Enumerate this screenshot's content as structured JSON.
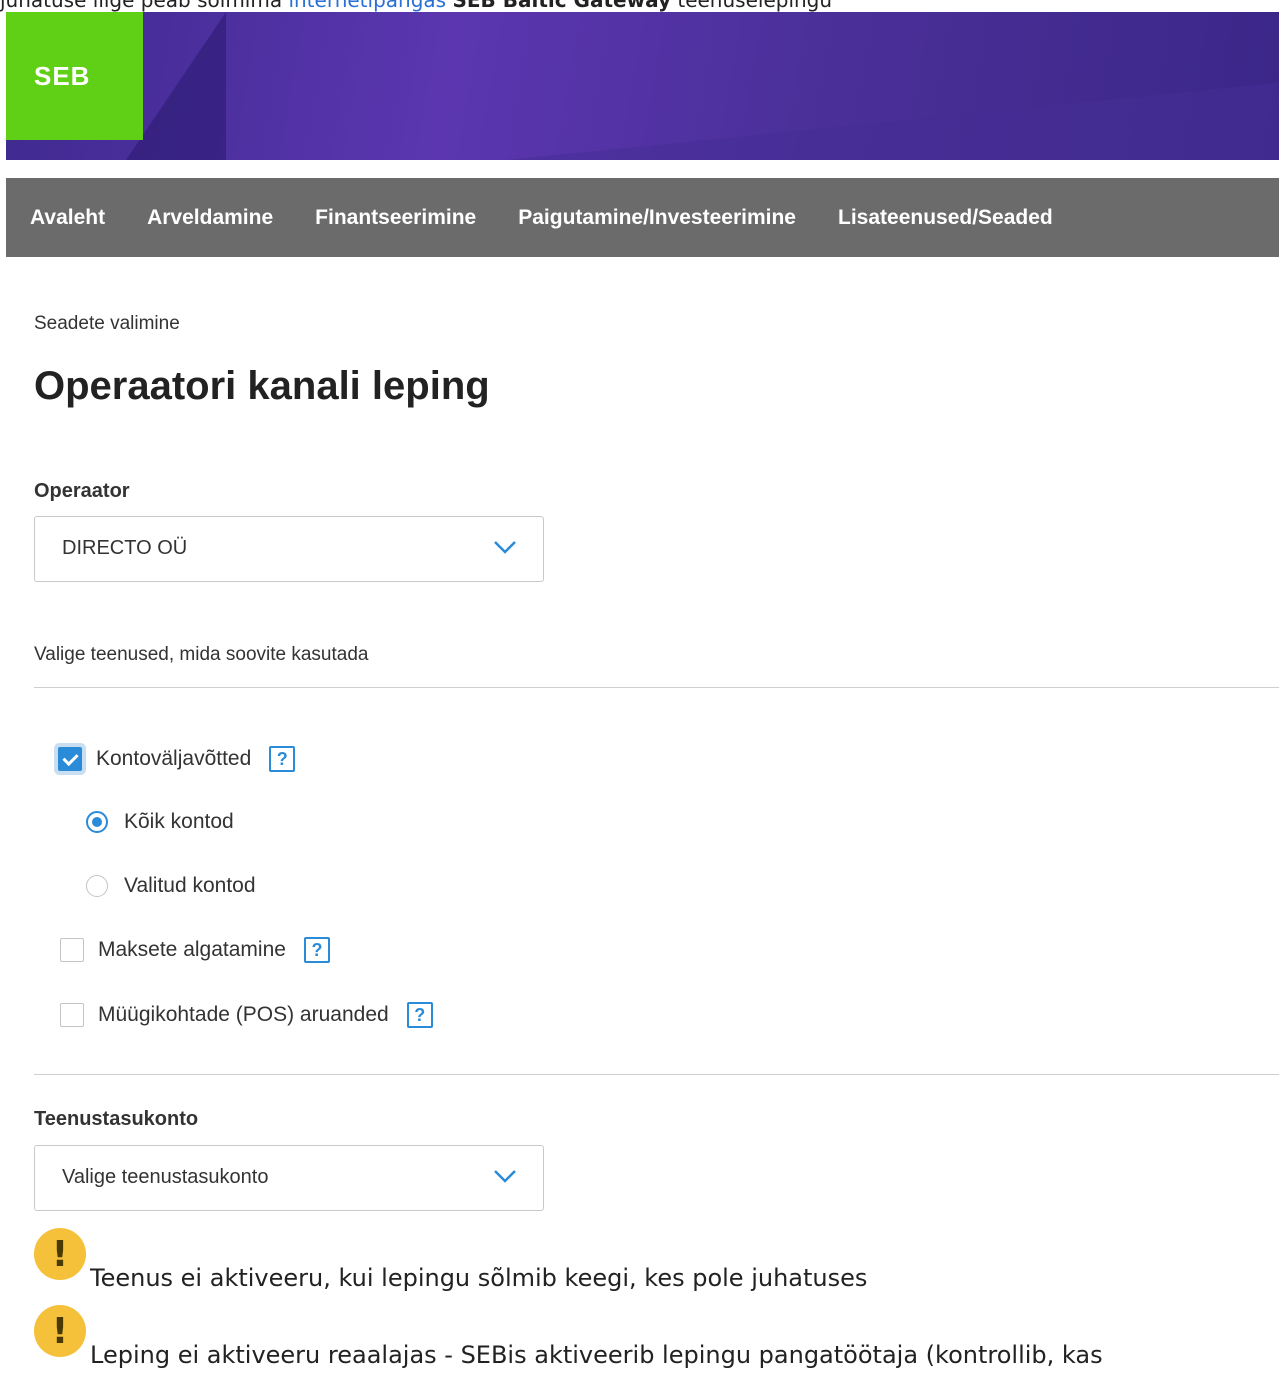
{
  "top_text": {
    "prefix": "juhatuse liige peab sõlmima ",
    "link": "internetipangas",
    "bold": "SEB Baltic Gateway",
    "suffix": " teenuselepingu"
  },
  "logo": {
    "text": "SEB",
    "color": "#5fd016"
  },
  "nav": {
    "items": [
      "Avaleht",
      "Arveldamine",
      "Finantseerimine",
      "Paigutamine/Investeerimine",
      "Lisateenused/Seaded"
    ]
  },
  "breadcrumb": "Seadete valimine",
  "page_title": "Operaatori kanali leping",
  "operator": {
    "label": "Operaator",
    "value": "DIRECTO OÜ"
  },
  "services": {
    "intro": "Valige teenused, mida soovite kasutada",
    "statements": {
      "label": "Kontoväljavõtted",
      "checked": true
    },
    "all_accounts": {
      "label": "Kõik kontod",
      "selected": true
    },
    "selected_accounts": {
      "label": "Valitud kontod",
      "selected": false
    },
    "payments": {
      "label": "Maksete algatamine",
      "checked": false
    },
    "pos": {
      "label": "Müügikohtade (POS) aruanded",
      "checked": false
    },
    "help_glyph": "?"
  },
  "fee_account": {
    "label": "Teenustasukonto",
    "placeholder": "Valige teenustasukonto"
  },
  "notices": [
    {
      "glyph": "!",
      "text": "Teenus ei aktiveeru, kui lepingu sõlmib keegi, kes pole juhatuses"
    },
    {
      "glyph": "!",
      "text": "Leping ei aktiveeru reaalajas - SEBis aktiveerib lepingu pangatöötaja (kontrollib, kas"
    }
  ],
  "colors": {
    "accent": "#2a8bd8",
    "nav_bg": "#6b6b6b",
    "warn": "#f5c03a"
  }
}
